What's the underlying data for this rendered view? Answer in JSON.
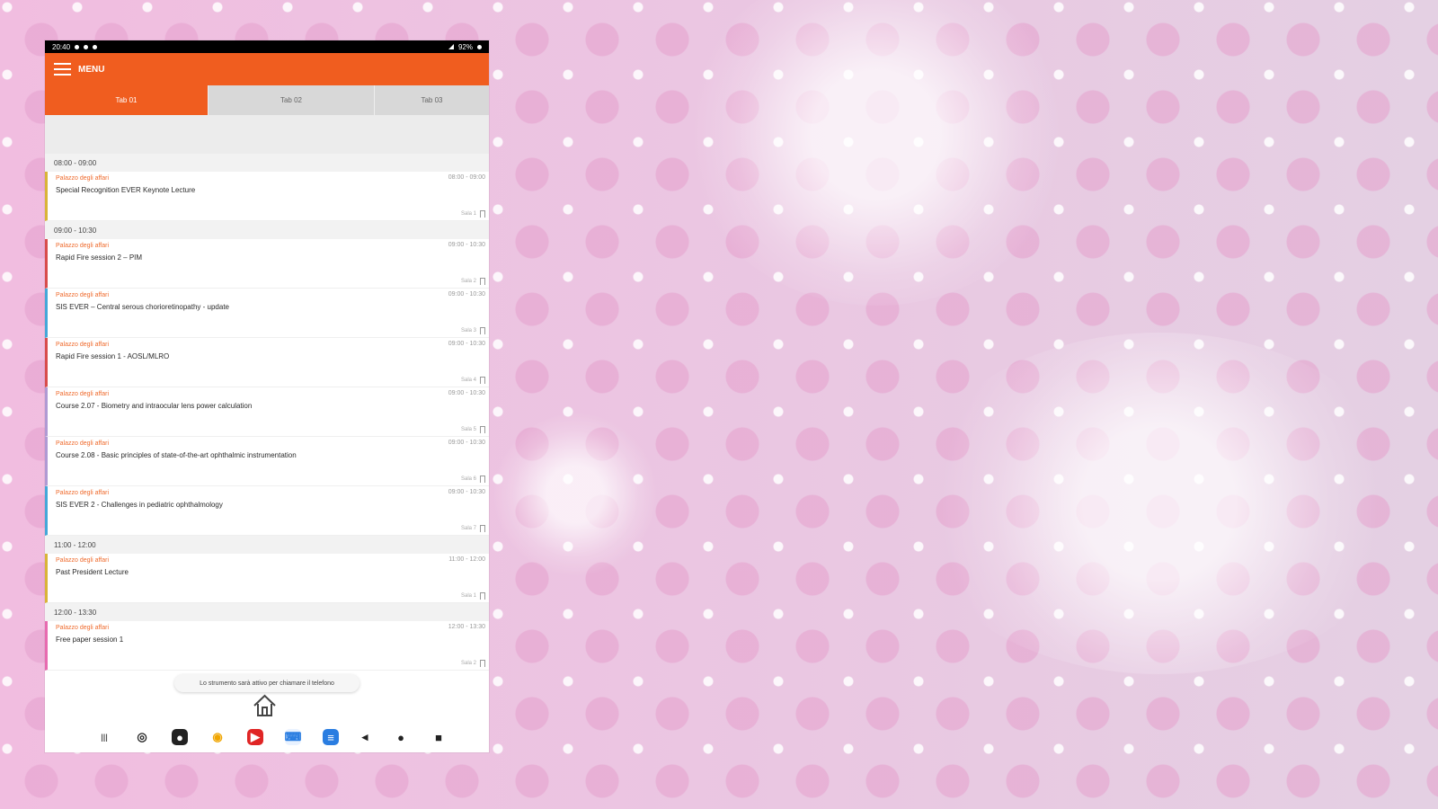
{
  "status_bar": {
    "time": "20:40",
    "battery": "92%"
  },
  "app_bar": {
    "menu_label": "Menu",
    "title": "MENU"
  },
  "tabs": [
    {
      "label": "Tab 01"
    },
    {
      "label": "Tab 02"
    },
    {
      "label": "Tab 03"
    }
  ],
  "agenda": [
    {
      "time_range": "08:00 - 09:00",
      "sessions": [
        {
          "room": "Palazzo degli affari",
          "title": "Special Recognition EVER Keynote Lecture",
          "time": "08:00 - 09:00",
          "meta": "Sala 1",
          "accent": "#d9b438"
        }
      ]
    },
    {
      "time_range": "09:00 - 10:30",
      "sessions": [
        {
          "room": "Palazzo degli affari",
          "title": "Rapid Fire session 2 – PIM",
          "time": "09:00 - 10:30",
          "meta": "Sala 2",
          "accent": "#d84c4c"
        },
        {
          "room": "Palazzo degli affari",
          "title": "SIS EVER – Central serous chorioretinopathy - update",
          "time": "09:00 - 10:30",
          "meta": "Sala 3",
          "accent": "#45a7d8"
        },
        {
          "room": "Palazzo degli affari",
          "title": "Rapid Fire session 1 - AOSL/MLRO",
          "time": "09:00 - 10:30",
          "meta": "Sala 4",
          "accent": "#d84c4c"
        },
        {
          "room": "Palazzo degli affari",
          "title": "Course 2.07 - Biometry and intraocular lens power calculation",
          "time": "09:00 - 10:30",
          "meta": "Sala 5",
          "accent": "#b09ad3"
        },
        {
          "room": "Palazzo degli affari",
          "title": "Course 2.08 - Basic principles of state-of-the-art ophthalmic instrumentation",
          "time": "09:00 - 10:30",
          "meta": "Sala 6",
          "accent": "#b09ad3"
        },
        {
          "room": "Palazzo degli affari",
          "title": "SIS EVER 2 - Challenges in pediatric ophthalmology",
          "time": "09:00 - 10:30",
          "meta": "Sala 7",
          "accent": "#45a7d8"
        }
      ]
    },
    {
      "time_range": "11:00 - 12:00",
      "sessions": [
        {
          "room": "Palazzo degli affari",
          "title": "Past President Lecture",
          "time": "11:00 - 12:00",
          "meta": "Sala 1",
          "accent": "#d9b438"
        }
      ]
    },
    {
      "time_range": "12:00 - 13:30",
      "sessions": [
        {
          "room": "Palazzo degli affari",
          "title": "Free paper session 1",
          "time": "12:00 - 13:30",
          "meta": "Sala 2",
          "accent": "#e76bb0"
        }
      ]
    }
  ],
  "toast": {
    "text": "Lo strumento sarà attivo per chiamare il telefono"
  },
  "dock": [
    {
      "name": "recents-icon",
      "glyph": "|||",
      "bg": "#ffffff",
      "color": "#555"
    },
    {
      "name": "settings-app-icon",
      "glyph": "◎",
      "bg": "#ffffff",
      "color": "#222"
    },
    {
      "name": "camera-app-icon",
      "glyph": "●",
      "bg": "#222222",
      "color": "#fff"
    },
    {
      "name": "chrome-app-icon",
      "glyph": "◉",
      "bg": "#ffffff",
      "color": "#f0a500"
    },
    {
      "name": "youtube-app-icon",
      "glyph": "▶",
      "bg": "#e02525",
      "color": "#fff"
    },
    {
      "name": "keyboard-app-icon",
      "glyph": "⌨",
      "bg": "#e9f2ff",
      "color": "#2a7de1"
    },
    {
      "name": "notes-app-icon",
      "glyph": "≡",
      "bg": "#2a7de1",
      "color": "#fff"
    },
    {
      "name": "back-icon",
      "glyph": "◂",
      "bg": "#ffffff",
      "color": "#222"
    },
    {
      "name": "home-nav-icon",
      "glyph": "●",
      "bg": "#ffffff",
      "color": "#222"
    },
    {
      "name": "overview-icon",
      "glyph": "■",
      "bg": "#ffffff",
      "color": "#222"
    }
  ]
}
